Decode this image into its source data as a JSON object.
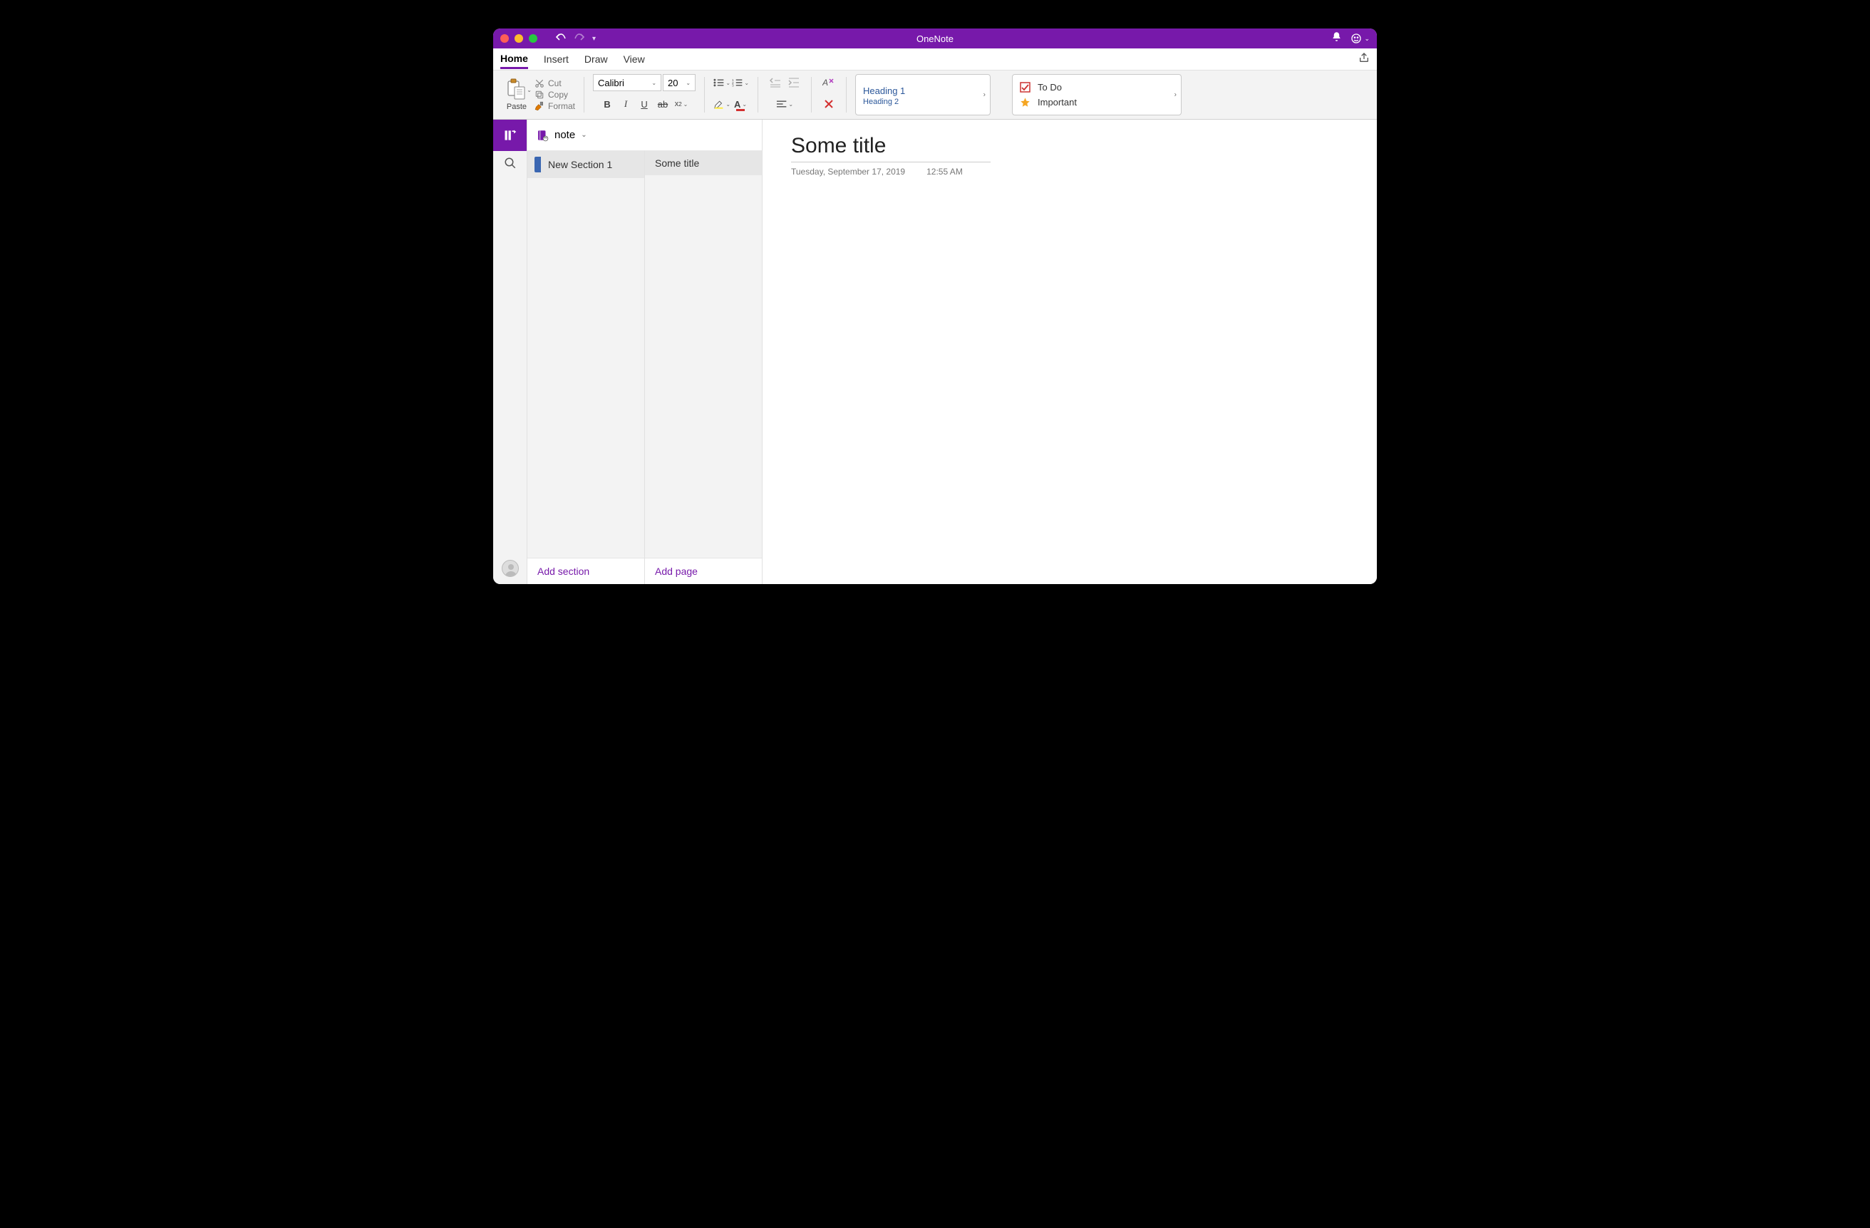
{
  "app": {
    "title": "OneNote"
  },
  "menu": {
    "tabs": [
      "Home",
      "Insert",
      "Draw",
      "View"
    ],
    "active": "Home"
  },
  "ribbon": {
    "paste_label": "Paste",
    "cut_label": "Cut",
    "copy_label": "Copy",
    "format_label": "Format",
    "font_name": "Calibri",
    "font_size": "20",
    "styles": {
      "heading1": "Heading 1",
      "heading2": "Heading 2"
    },
    "tags": {
      "todo": "To Do",
      "important": "Important"
    }
  },
  "notebook": {
    "name": "note",
    "sections": [
      {
        "name": "New Section 1",
        "color": "#3a66b1"
      }
    ],
    "pages": [
      {
        "title": "Some title"
      }
    ],
    "add_section_label": "Add section",
    "add_page_label": "Add page"
  },
  "page": {
    "title": "Some title",
    "date": "Tuesday, September 17, 2019",
    "time": "12:55 AM"
  }
}
